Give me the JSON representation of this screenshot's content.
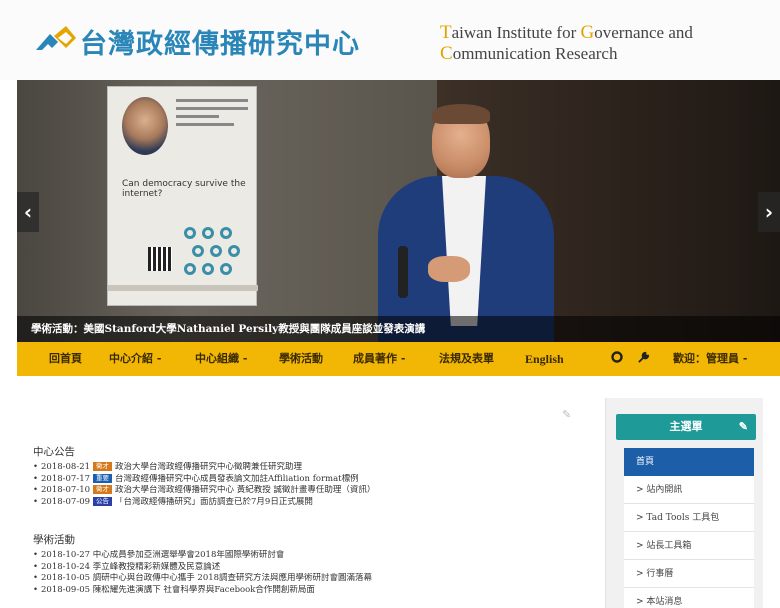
{
  "header": {
    "title_cn": "台灣政經傳播研究中心",
    "title_en_line1": [
      {
        "text": "T",
        "cap": true
      },
      {
        "text": "aiwan Institute for ",
        "cap": false
      },
      {
        "text": "G",
        "cap": true
      },
      {
        "text": "overnance and",
        "cap": false
      }
    ],
    "title_en_line2": [
      {
        "text": "C",
        "cap": true
      },
      {
        "text": "ommunication Research",
        "cap": false
      }
    ]
  },
  "slider": {
    "caption": "學術活動：美國Stanford大學Nathaniel Persily教授與團隊成員座談並發表演講",
    "poster_question": "Can democracy survive the internet?",
    "prev_icon": "chevron-left-icon",
    "next_icon": "chevron-right-icon"
  },
  "nav": {
    "items": [
      {
        "label": "回首頁",
        "icon": null
      },
      {
        "label": "中心介紹 -",
        "icon": null
      },
      {
        "label": "中心組織 -",
        "icon": null
      },
      {
        "label": "學術活動",
        "icon": null
      },
      {
        "label": "成員著作 -",
        "icon": null
      },
      {
        "label": "法規及表單",
        "icon": null
      },
      {
        "label": "English",
        "icon": null
      }
    ],
    "right": {
      "circle_icon": "circle-icon",
      "wrench_icon": "wrench-icon",
      "welcome": "歡迎：管理員 -"
    }
  },
  "announcements": {
    "title": "中心公告",
    "items": [
      {
        "date": "2018-08-21",
        "badge": "徵才",
        "badge_color": "orange",
        "text": "政治大學台灣政經傳播研究中心徵聘兼任研究助理"
      },
      {
        "date": "2018-07-17",
        "badge": "重要",
        "badge_color": "blue",
        "text": "台灣政經傳播研究中心成員發表論文加註Affiliation format標例"
      },
      {
        "date": "2018-07-10",
        "badge": "徵才",
        "badge_color": "orange",
        "text": "政治大學台灣政經傳播研究中心 黃紀教授 誠徵計畫專任助理（資訊）"
      },
      {
        "date": "2018-07-09",
        "badge": "公告",
        "badge_color": "darkblue",
        "text": "「台灣政經傳播研究」面訪調查已於7月9日正式展開"
      }
    ]
  },
  "activities": {
    "title": "學術活動",
    "items": [
      {
        "date": "2018-10-27",
        "text": "中心成員參加亞洲選舉學會2018年國際學術研討會"
      },
      {
        "date": "2018-10-24",
        "text": "李立峰教授精彩新媒體及民意論述"
      },
      {
        "date": "2018-10-05",
        "text": "調研中心與台政傳中心攜手 2018調查研究方法與應用學術研討會圓滿落幕"
      },
      {
        "date": "2018-09-05",
        "text": "陳松耀先進演講下 社會科學界與Facebook合作開創新局面"
      }
    ]
  },
  "sidebar": {
    "title": "主選單",
    "items": [
      {
        "label": "首頁",
        "active": true
      },
      {
        "label": "> 站內開訊",
        "active": false
      },
      {
        "label": "> Tad Tools 工具包",
        "active": false
      },
      {
        "label": "> 站長工具箱",
        "active": false
      },
      {
        "label": "> 行事曆",
        "active": false
      },
      {
        "label": "> 本站消息",
        "active": false
      }
    ]
  }
}
